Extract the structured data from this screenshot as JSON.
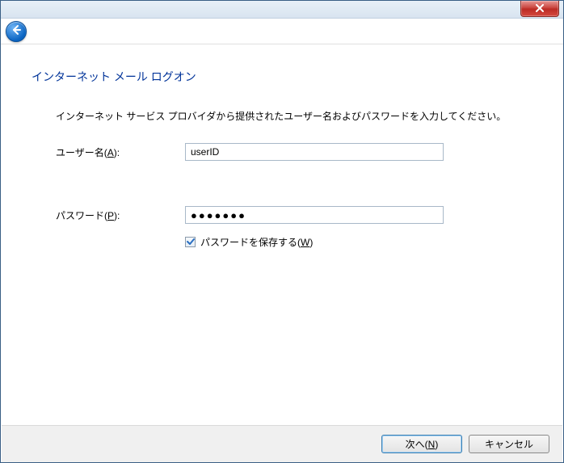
{
  "header": {
    "title": "インターネット メール ログオン",
    "instruction": "インターネット サービス プロバイダから提供されたユーザー名およびパスワードを入力してください。"
  },
  "form": {
    "username": {
      "label_prefix": "ユーザー名(",
      "access_key": "A",
      "label_suffix": "):",
      "value": "userID"
    },
    "password": {
      "label_prefix": "パスワード(",
      "access_key": "P",
      "label_suffix": "):",
      "value_display": "●●●●●●●"
    },
    "remember": {
      "checked": true,
      "label_prefix": "パスワードを保存する(",
      "access_key": "W",
      "label_suffix": ")"
    }
  },
  "buttons": {
    "next_prefix": "次へ(",
    "next_key": "N",
    "next_suffix": ")",
    "cancel": "キャンセル"
  }
}
